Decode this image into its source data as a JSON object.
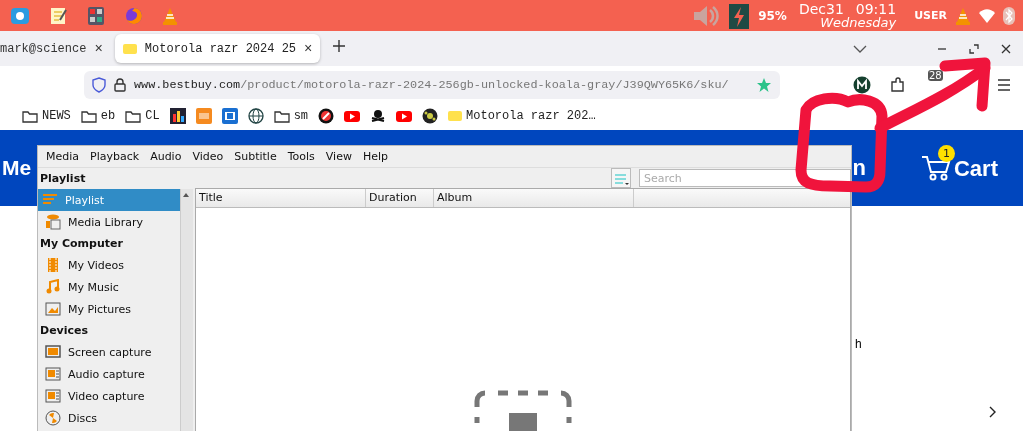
{
  "top_panel": {
    "battery": "95%",
    "date": "Dec31",
    "time": "09:11",
    "weekday": "Wednesday",
    "user": "USER"
  },
  "browser": {
    "tabs": [
      {
        "label": "mark@science",
        "close": "×",
        "selected": false
      },
      {
        "label": "Motorola razr 2024 25",
        "close": "×",
        "selected": true
      }
    ],
    "address": {
      "host": "www.bestbuy.com",
      "path": "/product/motorola-razr-2024-256gb-unlocked-koala-gray/J39QWY65K6/sku/"
    },
    "extension_badge": "28",
    "bookmarks": [
      {
        "kind": "folder",
        "label": "NEWS"
      },
      {
        "kind": "folder",
        "label": "eb"
      },
      {
        "kind": "folder",
        "label": "CL"
      },
      {
        "kind": "site"
      },
      {
        "kind": "site"
      },
      {
        "kind": "site"
      },
      {
        "kind": "site"
      },
      {
        "kind": "folder",
        "label": "sm"
      },
      {
        "kind": "site"
      },
      {
        "kind": "site"
      },
      {
        "kind": "site"
      },
      {
        "kind": "site"
      },
      {
        "kind": "site"
      },
      {
        "kind": "page",
        "label": "Motorola razr 202…"
      }
    ]
  },
  "page": {
    "header_text": "Me",
    "header_fragment": "n",
    "cart": {
      "label": "Cart",
      "count": "1"
    },
    "body_fragment": "h"
  },
  "vlc": {
    "menu": [
      "Media",
      "Playback",
      "Audio",
      "Video",
      "Subtitle",
      "Tools",
      "View",
      "Help"
    ],
    "sidebar": [
      {
        "title": "Playlist",
        "items": [
          {
            "label": "Playlist",
            "selected": true
          },
          {
            "label": "Media Library",
            "selected": false
          }
        ]
      },
      {
        "title": "My Computer",
        "items": [
          {
            "label": "My Videos",
            "selected": false
          },
          {
            "label": "My Music",
            "selected": false
          },
          {
            "label": "My Pictures",
            "selected": false
          }
        ]
      },
      {
        "title": "Devices",
        "items": [
          {
            "label": "Screen capture",
            "selected": false
          },
          {
            "label": "Audio capture",
            "selected": false
          },
          {
            "label": "Video capture",
            "selected": false
          },
          {
            "label": "Discs",
            "selected": false
          }
        ]
      }
    ],
    "search": {
      "placeholder": "Search"
    },
    "columns": [
      "Title",
      "Duration",
      "Album"
    ]
  }
}
